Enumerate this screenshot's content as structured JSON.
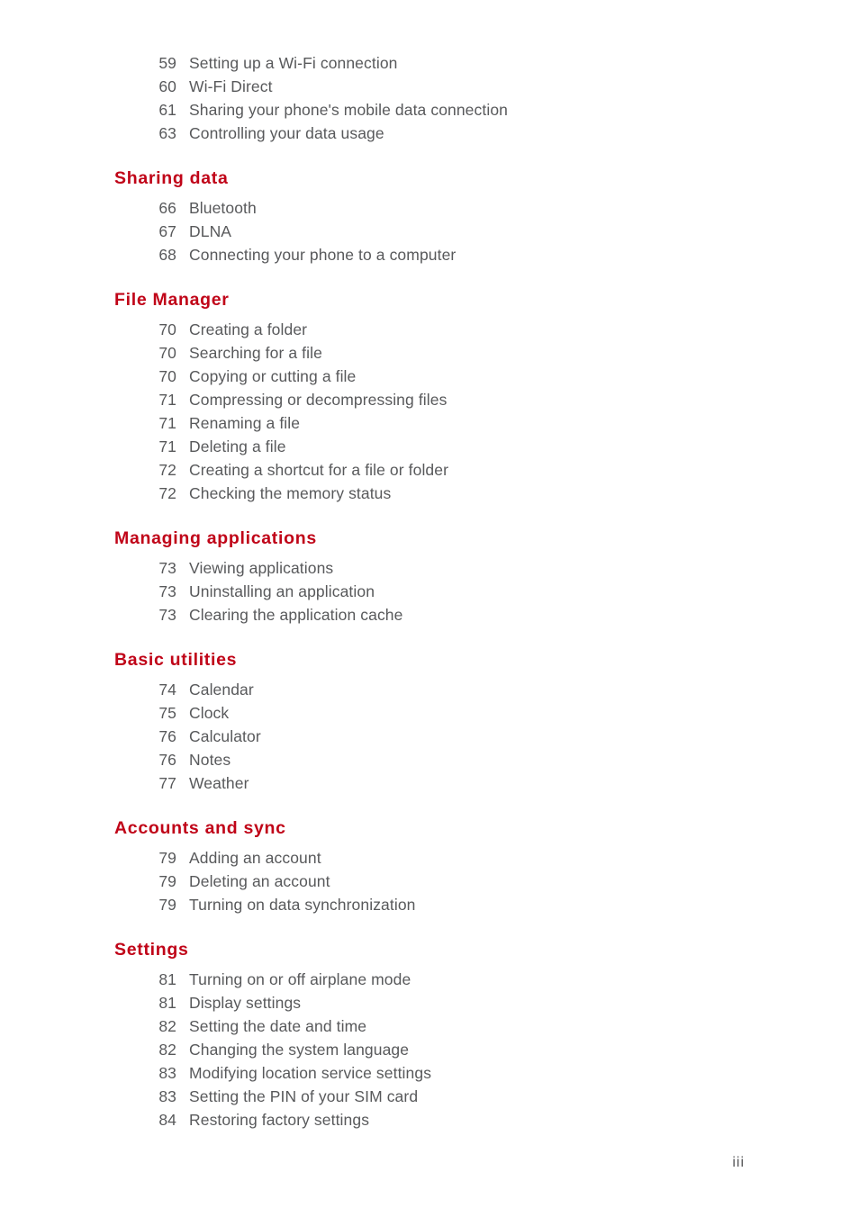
{
  "page": {
    "folio": "iii",
    "heading_color": "#c00418",
    "text_color": "#58595b",
    "background_color": "#ffffff"
  },
  "intro_entries": [
    {
      "page": "59",
      "title": "Setting up a Wi-Fi connection"
    },
    {
      "page": "60",
      "title": "Wi-Fi Direct"
    },
    {
      "page": "61",
      "title": "Sharing your phone's mobile data connection"
    },
    {
      "page": "63",
      "title": "Controlling your data usage"
    }
  ],
  "sections": [
    {
      "heading": "Sharing data",
      "entries": [
        {
          "page": "66",
          "title": "Bluetooth"
        },
        {
          "page": "67",
          "title": "DLNA"
        },
        {
          "page": "68",
          "title": "Connecting your phone to a computer"
        }
      ]
    },
    {
      "heading": "File Manager",
      "entries": [
        {
          "page": "70",
          "title": "Creating a folder"
        },
        {
          "page": "70",
          "title": "Searching for a file"
        },
        {
          "page": "70",
          "title": "Copying or cutting a file"
        },
        {
          "page": "71",
          "title": "Compressing or decompressing files"
        },
        {
          "page": "71",
          "title": "Renaming a file"
        },
        {
          "page": "71",
          "title": "Deleting a file"
        },
        {
          "page": "72",
          "title": "Creating a shortcut for a file or folder"
        },
        {
          "page": "72",
          "title": "Checking the memory status"
        }
      ]
    },
    {
      "heading": "Managing applications",
      "entries": [
        {
          "page": "73",
          "title": "Viewing applications"
        },
        {
          "page": "73",
          "title": "Uninstalling an application"
        },
        {
          "page": "73",
          "title": "Clearing the application cache"
        }
      ]
    },
    {
      "heading": "Basic utilities",
      "entries": [
        {
          "page": "74",
          "title": "Calendar"
        },
        {
          "page": "75",
          "title": "Clock"
        },
        {
          "page": "76",
          "title": "Calculator"
        },
        {
          "page": "76",
          "title": "Notes"
        },
        {
          "page": "77",
          "title": "Weather"
        }
      ]
    },
    {
      "heading": "Accounts and sync",
      "entries": [
        {
          "page": "79",
          "title": "Adding an account"
        },
        {
          "page": "79",
          "title": "Deleting an account"
        },
        {
          "page": "79",
          "title": "Turning on data synchronization"
        }
      ]
    },
    {
      "heading": "Settings",
      "entries": [
        {
          "page": "81",
          "title": "Turning on or off airplane mode"
        },
        {
          "page": "81",
          "title": "Display settings"
        },
        {
          "page": "82",
          "title": "Setting the date and time"
        },
        {
          "page": "82",
          "title": "Changing the system language"
        },
        {
          "page": "83",
          "title": "Modifying location service settings"
        },
        {
          "page": "83",
          "title": "Setting the PIN of your SIM card"
        },
        {
          "page": "84",
          "title": "Restoring factory settings"
        }
      ]
    }
  ]
}
